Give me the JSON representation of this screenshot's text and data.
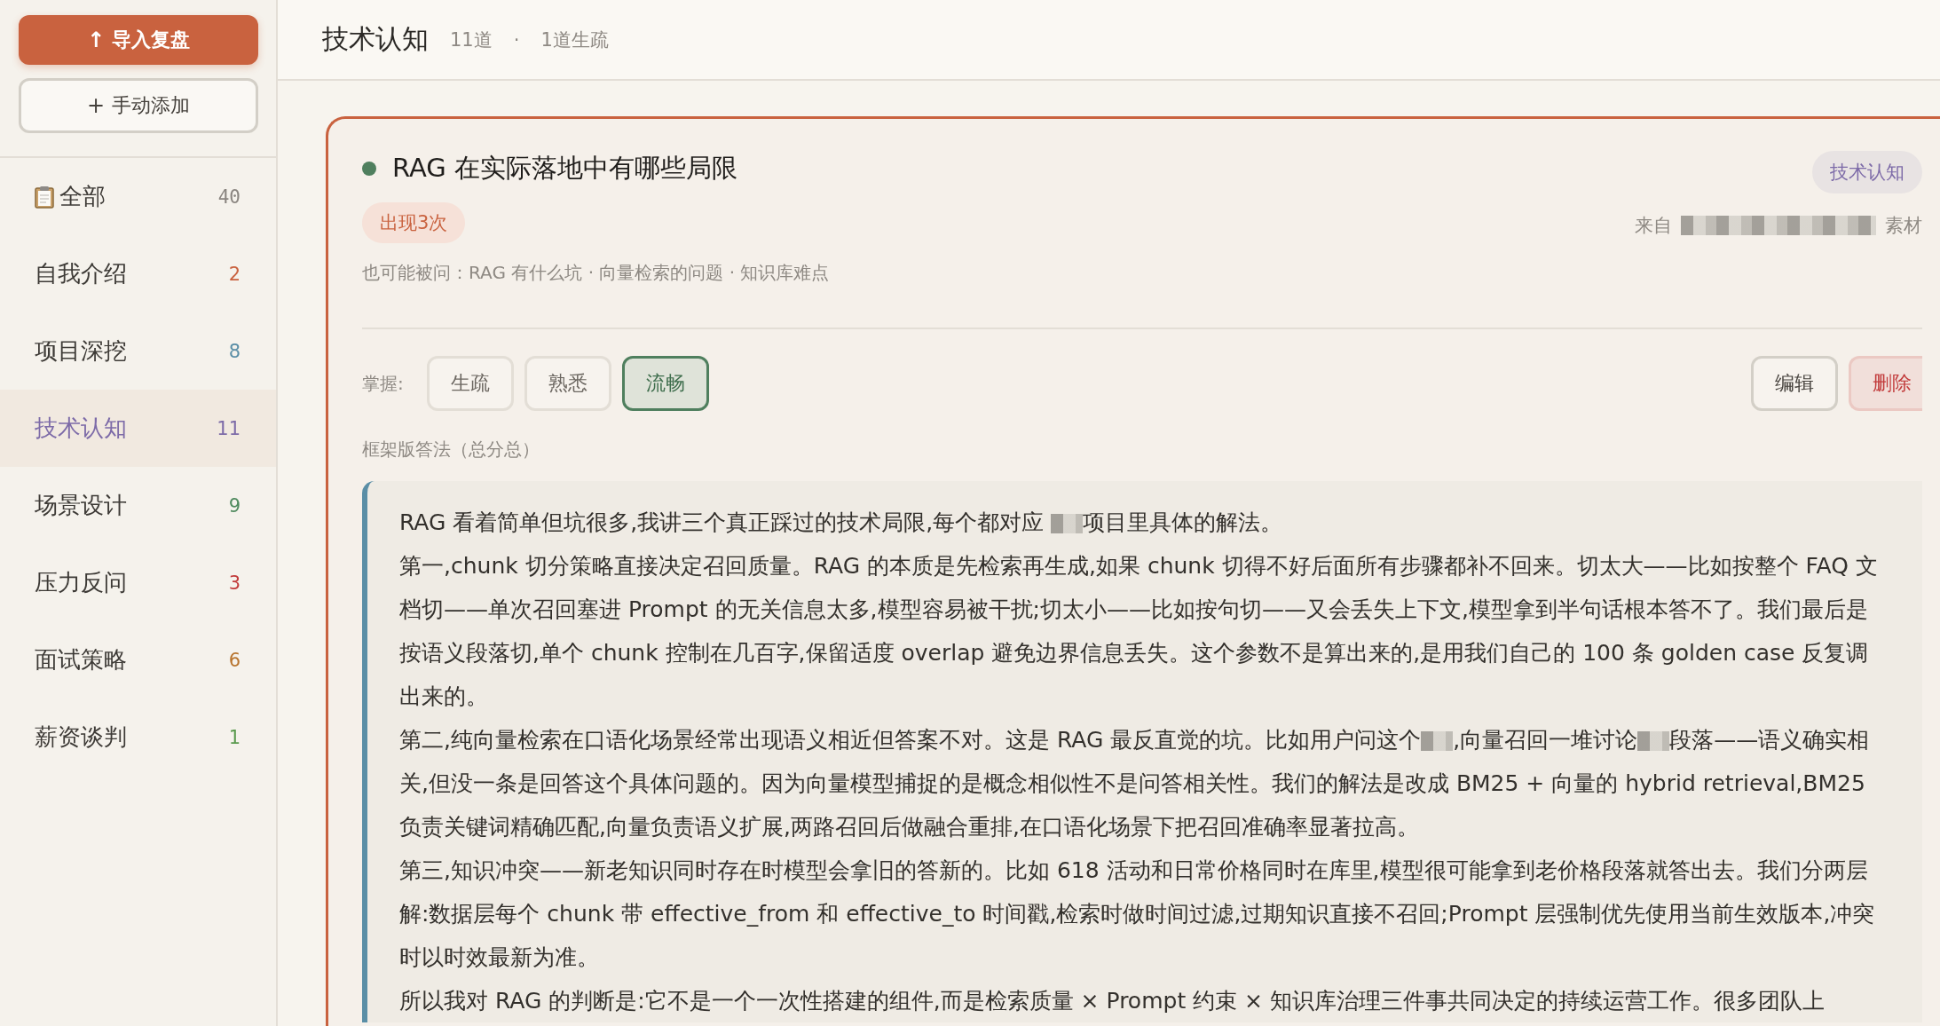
{
  "sidebar": {
    "import_button": {
      "icon": "↑",
      "label": "导入复盘"
    },
    "add_button": {
      "icon": "+",
      "label": "手动添加"
    },
    "items": [
      {
        "label": "全部",
        "count": "40",
        "selected": false,
        "color": "#8a8580",
        "kind": "all"
      },
      {
        "label": "自我介绍",
        "count": "2",
        "selected": false,
        "color": "#c9623f",
        "kind": "category"
      },
      {
        "label": "项目深挖",
        "count": "8",
        "selected": false,
        "color": "#5a8ea6",
        "kind": "category"
      },
      {
        "label": "技术认知",
        "count": "11",
        "selected": true,
        "color": "#7d6ba8",
        "kind": "category"
      },
      {
        "label": "场景设计",
        "count": "9",
        "selected": false,
        "color": "#4f8a5e",
        "kind": "category"
      },
      {
        "label": "压力反问",
        "count": "3",
        "selected": false,
        "color": "#c23b3b",
        "kind": "category"
      },
      {
        "label": "面试策略",
        "count": "6",
        "selected": false,
        "color": "#b8742e",
        "kind": "category"
      },
      {
        "label": "薪资谈判",
        "count": "1",
        "selected": false,
        "color": "#5a9a4e",
        "kind": "category"
      }
    ]
  },
  "header": {
    "title": "技术认知",
    "count": "11道",
    "separator": "·",
    "unfamiliar": "1道生疏"
  },
  "card": {
    "title": "RAG 在实际落地中有哪些局限",
    "occurrences": "出现3次",
    "tag": "技术认知",
    "source": [
      {
        "kind": "text",
        "text": "来自"
      },
      {
        "kind": "redacted"
      },
      {
        "kind": "text",
        "text": "素材"
      }
    ],
    "also_asked": "也可能被问：RAG 有什么坑 · 向量检索的问题 · 知识库难点",
    "mastery_label": "掌握:",
    "mastery": [
      {
        "label": "生疏",
        "selected": false
      },
      {
        "label": "熟悉",
        "selected": false
      },
      {
        "label": "流畅",
        "selected": true
      }
    ],
    "edit_button": "编辑",
    "delete_button": "删除",
    "answer_label": "框架版答法（总分总）",
    "answer": [
      [
        {
          "kind": "text",
          "text": "RAG 看着简单但坑很多,我讲三个真正踩过的技术局限,每个都对应 "
        },
        {
          "kind": "redacted"
        },
        {
          "kind": "text",
          "text": "项目里具体的解法。"
        }
      ],
      [
        {
          "kind": "text",
          "text": "第一,chunk 切分策略直接决定召回质量。RAG 的本质是先检索再生成,如果 chunk 切得不好后面所有步骤都补不回来。切太大——比如按整个 FAQ 文档切——单次召回塞进 Prompt 的无关信息太多,模型容易被干扰;切太小——比如按句切——又会丢失上下文,模型拿到半句话根本答不了。我们最后是按语义段落切,单个 chunk 控制在几百字,保留适度 overlap 避免边界信息丢失。这个参数不是算出来的,是用我们自己的 100 条 golden case 反复调出来的。"
        }
      ],
      [
        {
          "kind": "text",
          "text": "第二,纯向量检索在口语化场景经常出现语义相近但答案不对。这是 RAG 最反直觉的坑。比如用户问这个"
        },
        {
          "kind": "redacted"
        },
        {
          "kind": "text",
          "text": ",向量召回一堆讨论"
        },
        {
          "kind": "redacted"
        },
        {
          "kind": "text",
          "text": "段落——语义确实相关,但没一条是回答这个具体问题的。因为向量模型捕捉的是概念相似性不是问答相关性。我们的解法是改成 BM25 + 向量的 hybrid retrieval,BM25 负责关键词精确匹配,向量负责语义扩展,两路召回后做融合重排,在口语化场景下把召回准确率显著拉高。"
        }
      ],
      [
        {
          "kind": "text",
          "text": "第三,知识冲突——新老知识同时存在时模型会拿旧的答新的。比如 618 活动和日常价格同时在库里,模型很可能拿到老价格段落就答出去。我们分两层解:数据层每个 chunk 带 effective_from 和 effective_to 时间戳,检索时做时间过滤,过期知识直接不召回;Prompt 层强制优先使用当前生效版本,冲突时以时效最新为准。"
        }
      ],
      [
        {
          "kind": "text",
          "text": "所以我对 RAG 的判断是:它不是一个一次性搭建的组件,而是检索质量 × Prompt 约束 × 知识库治理三件事共同决定的持续运营工作。很多团队上"
        }
      ]
    ]
  }
}
